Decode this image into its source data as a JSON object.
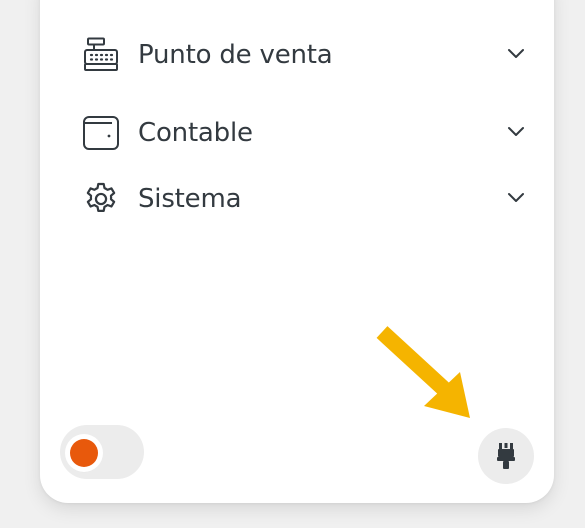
{
  "menu": {
    "items": [
      {
        "label": "Punto de venta",
        "icon": "cash-register-icon"
      },
      {
        "label": "Contable",
        "icon": "wallet-icon"
      },
      {
        "label": "Sistema",
        "icon": "gear-icon"
      }
    ]
  },
  "footer": {
    "toggle_state": "on",
    "toggle_color": "#e8590c",
    "button_icon": "paint-brush-icon"
  },
  "annotation": {
    "arrow_color": "#f5b400"
  }
}
